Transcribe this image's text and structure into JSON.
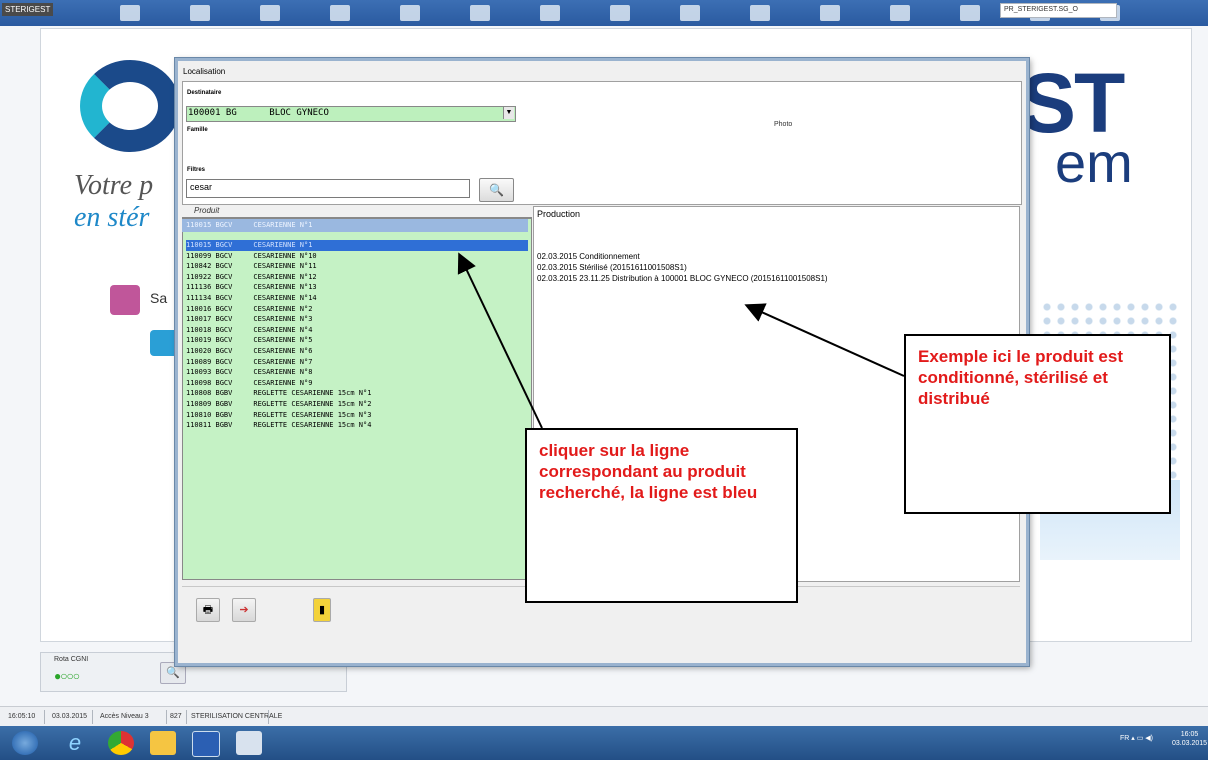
{
  "app": {
    "title": "STERIGEST"
  },
  "background": {
    "tagline_1": "Votre p",
    "tagline_2": "en stér",
    "brand_fragment": "ST",
    "brand_fragment_2": "em",
    "side_label": "Sa",
    "rota_label": "Rota CGNI",
    "rota_indicator": "●○○○",
    "rota_button_icon": "magnifier-icon"
  },
  "status_bar": {
    "time": "16:05:10",
    "date": "03.03.2015",
    "access": "Accès Niveau 3",
    "code": "827",
    "service": "STERILISATION CENTRALE",
    "right_field": "PR_STERIGEST.SG_O"
  },
  "taskbar": {
    "tray": "FR  ▴  ▭  ◀)",
    "clock_time": "16:05",
    "clock_date": "03.03.2015"
  },
  "dialog": {
    "title": "Localisation",
    "destinataire_label": "Destinataire",
    "destinataire_value": "100001 BG      BLOC GYNECO",
    "famille_label": "Famille",
    "filtres_label": "Filtres",
    "filtre_value": "cesar",
    "photo_label": "Photo",
    "search_icon": "magnifier-icon",
    "product_header": "Produit",
    "production_header": "Production",
    "selected_row_top": "110015 BGCV     CESARIENNE N°1",
    "products": [
      "110015 BGCV     CESARIENNE N°1",
      "110099 BGCV     CESARIENNE N°10",
      "110842 BGCV     CESARIENNE N°11",
      "110922 BGCV     CESARIENNE N°12",
      "111136 BGCV     CESARIENNE N°13",
      "111134 BGCV     CESARIENNE N°14",
      "110016 BGCV     CESARIENNE N°2",
      "110017 BGCV     CESARIENNE N°3",
      "110018 BGCV     CESARIENNE N°4",
      "110019 BGCV     CESARIENNE N°5",
      "110020 BGCV     CESARIENNE N°6",
      "110089 BGCV     CESARIENNE N°7",
      "110093 BGCV     CESARIENNE N°8",
      "110098 BGCV     CESARIENNE N°9",
      "110808 BGBV     REGLETTE CESARIENNE 15cm N°1",
      "110809 BGBV     REGLETTE CESARIENNE 15cm N°2",
      "110810 BGBV     REGLETTE CESARIENNE 15cm N°3",
      "110811 BGBV     REGLETTE CESARIENNE 15cm N°4"
    ],
    "production_lines": [
      "02.03.2015 Conditionnement",
      "02.03.2015 Stérilisé  (20151611001508S1)",
      "02.03.2015 23.11.25 Distribution à 100001 BLOC GYNECO (20151611001508S1)"
    ],
    "toolbar_icons": [
      "print-icon",
      "export-icon",
      "exit-door-icon"
    ]
  },
  "annotations": {
    "callout_left": "cliquer sur la ligne correspondant au produit recherché, la ligne est bleu",
    "callout_right": "Exemple ici le produit est conditionné, stérilisé et distribué"
  },
  "colors": {
    "list_bg": "#c5f2c5",
    "selection": "#2f6fd6",
    "annotation_text": "#e21a1a"
  }
}
